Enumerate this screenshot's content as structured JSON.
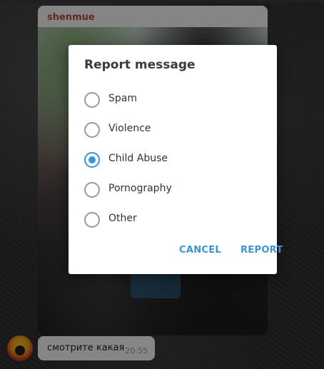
{
  "chat": {
    "sender_name": "shenmue",
    "message_text": "смотрите какая",
    "message_time": "20:55"
  },
  "dialog": {
    "title": "Report message",
    "options": [
      {
        "label": "Spam",
        "checked": false
      },
      {
        "label": "Violence",
        "checked": false
      },
      {
        "label": "Child Abuse",
        "checked": true
      },
      {
        "label": "Pornography",
        "checked": false
      },
      {
        "label": "Other",
        "checked": false
      }
    ],
    "cancel_label": "CANCEL",
    "report_label": "REPORT"
  },
  "colors": {
    "accent": "#3a95d5",
    "sender": "#b24a3a"
  }
}
